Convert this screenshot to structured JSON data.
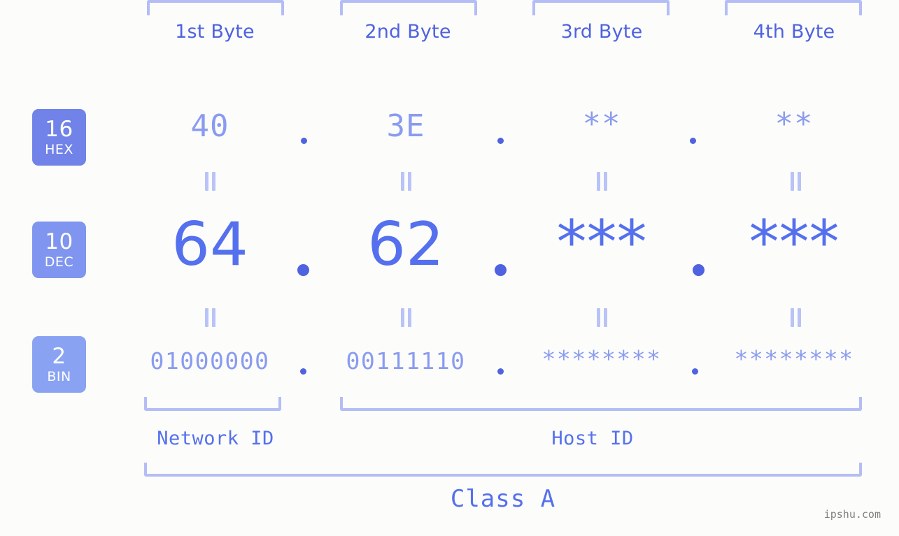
{
  "background_color": "#fcfdfa",
  "accent_color": "#5570ee",
  "muted_color": "#8a9bf0",
  "bracket_color": "#b4bdf6",
  "byte_headers": [
    {
      "label": "1st Byte"
    },
    {
      "label": "2nd Byte"
    },
    {
      "label": "3rd Byte"
    },
    {
      "label": "4th Byte"
    }
  ],
  "bases": [
    {
      "number": "16",
      "name": "HEX",
      "color": "#7183e8"
    },
    {
      "number": "10",
      "name": "DEC",
      "color": "#7f95ef"
    },
    {
      "number": "2",
      "name": "BIN",
      "color": "#8aa2f2"
    }
  ],
  "rows": {
    "hex": {
      "values": [
        "40",
        "3E",
        "**",
        "**"
      ],
      "separator": "."
    },
    "dec": {
      "values": [
        "64",
        "62",
        "***",
        "***"
      ],
      "separator": "."
    },
    "bin": {
      "values": [
        "01000000",
        "00111110",
        "********",
        "********"
      ],
      "separator": "."
    }
  },
  "equals_mark": "||",
  "regions": [
    {
      "label": "Network ID"
    },
    {
      "label": "Host ID"
    }
  ],
  "class": {
    "label": "Class A"
  },
  "watermark": {
    "text": "ipshu.com"
  }
}
